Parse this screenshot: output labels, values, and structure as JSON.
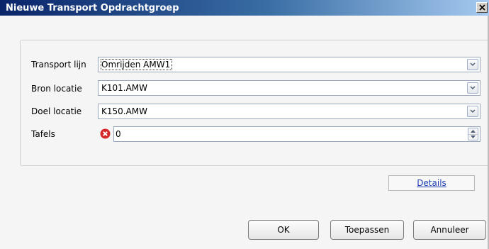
{
  "window": {
    "title": "Nieuwe Transport Opdrachtgroep",
    "close_glyph": "✕"
  },
  "form": {
    "transport_lijn": {
      "label": "Transport lijn",
      "value": "Omrijden AMW1"
    },
    "bron_locatie": {
      "label": "Bron locatie",
      "value": "K101.AMW"
    },
    "doel_locatie": {
      "label": "Doel locatie",
      "value": "K150.AMW"
    },
    "tafels": {
      "label": "Tafels",
      "value": "0",
      "error_color": "#d42a2a"
    }
  },
  "details_link": "Details",
  "buttons": {
    "ok": "OK",
    "apply": "Toepassen",
    "cancel": "Annuleer"
  },
  "colors": {
    "titlebar_start": "#0a246a",
    "titlebar_end": "#a6caf0",
    "link": "#1f3fb0"
  }
}
